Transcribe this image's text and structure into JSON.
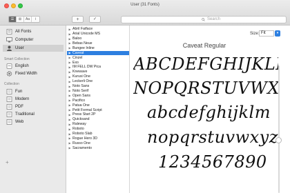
{
  "window": {
    "title": "User (31 Fonts)"
  },
  "toolbar": {
    "view_buttons": [
      "☰",
      "⊞",
      "Aa",
      "i"
    ],
    "add_label": "+",
    "check_label": "✓",
    "search_placeholder": "Search"
  },
  "sidebar": {
    "items": [
      {
        "label": "All Fonts",
        "icon": "fonts-icon"
      },
      {
        "label": "Computer",
        "icon": "computer-icon"
      },
      {
        "label": "User",
        "icon": "user-icon",
        "selected": true
      }
    ],
    "smart_header": "Smart Collection",
    "smart_items": [
      {
        "label": "English",
        "icon": "smart-collection-icon"
      },
      {
        "label": "Fixed Width",
        "icon": "gear-icon"
      }
    ],
    "collection_header": "Collection",
    "collection_items": [
      {
        "label": "Fun"
      },
      {
        "label": "Modern"
      },
      {
        "label": "PDF"
      },
      {
        "label": "Traditional"
      },
      {
        "label": "Web"
      }
    ],
    "add_label": "+"
  },
  "font_list": {
    "fonts": [
      "Abril Fatface",
      "Arial Unicode MS",
      "Baloo",
      "Bebas Neue",
      "Bungee Inline",
      "Caveat",
      "Cinzel",
      "Exo",
      "IM FELL DW Pica",
      "Knewave",
      "Kurusi One",
      "Leckerli One",
      "Noto Sans",
      "Noto Serif",
      "Open Sans",
      "Pacifico",
      "Patua One",
      "Petit Formal Script",
      "Press Start 2P",
      "Quicksand",
      "Raleway",
      "Roboto",
      "Roboto Slab",
      "Rogue Hero 3D",
      "Russo One",
      "Sacramento"
    ],
    "selected": "Caveat"
  },
  "preview": {
    "size_label": "Size:",
    "size_value": "Fit",
    "face_name": "Caveat Regular",
    "lines": [
      "ABCDEFGHIJKLM",
      "NOPQRSTUVWXYZ",
      "abcdefghijklm",
      "nopqrstuvwxyz",
      "1234567890"
    ]
  }
}
